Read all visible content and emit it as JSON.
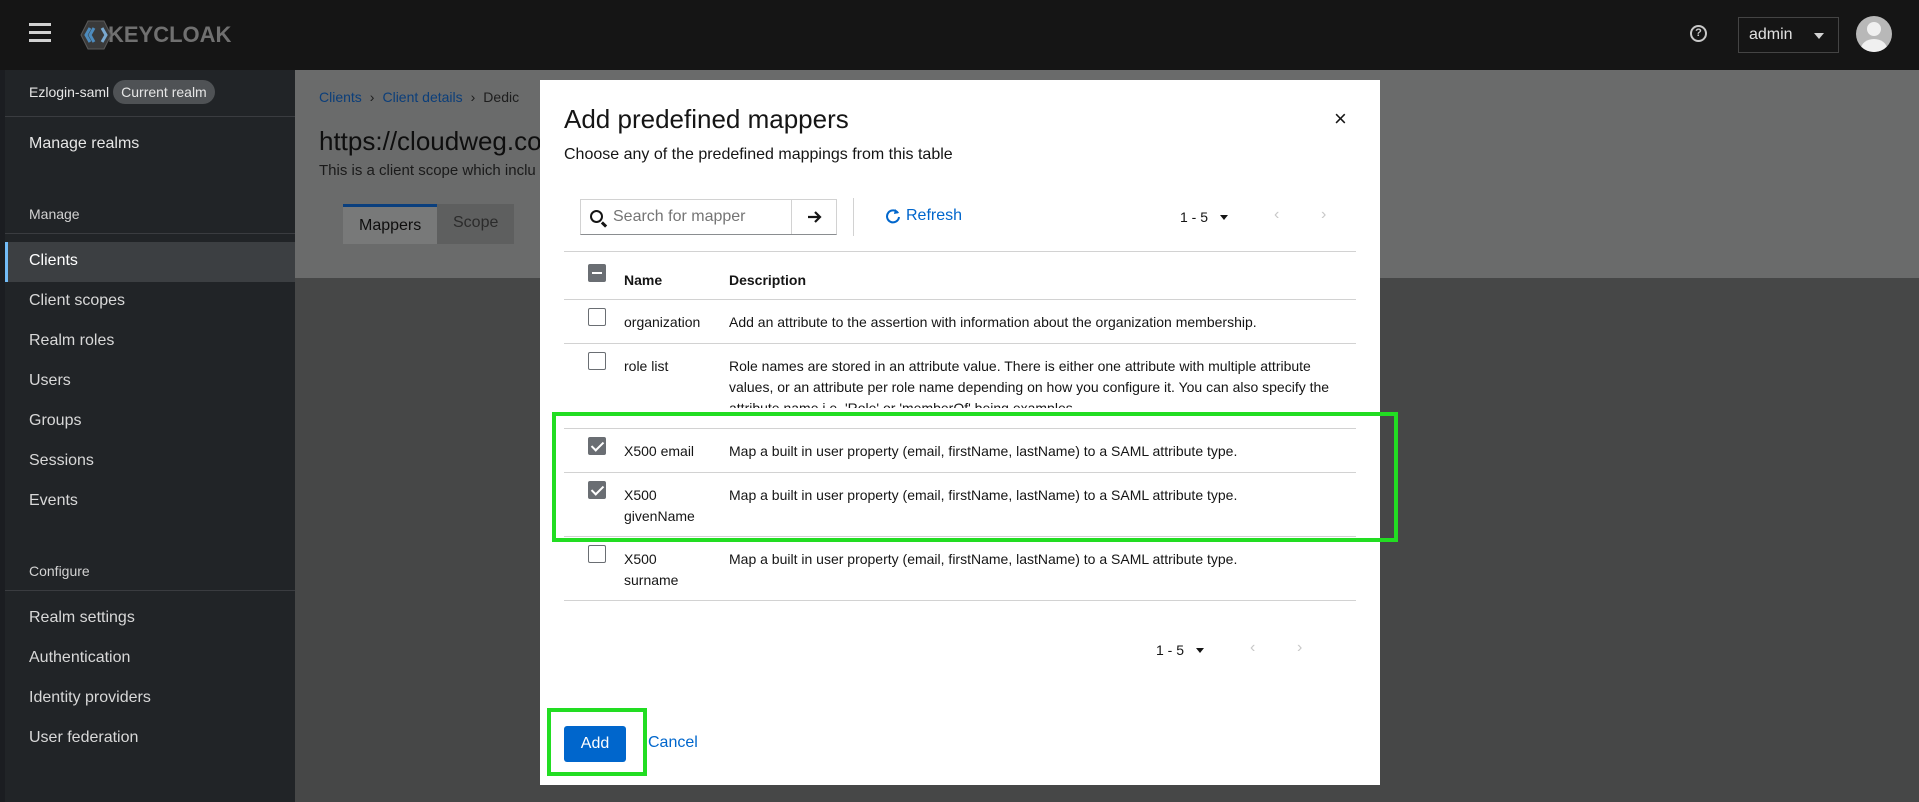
{
  "masthead": {
    "brand": "KEYCLOAK",
    "user": "admin",
    "help_glyph": "?"
  },
  "sidebar": {
    "realm_name": "Ezlogin-saml",
    "realm_badge": "Current realm",
    "manage_realms": "Manage realms",
    "manage_section": "Manage",
    "manage_items": [
      "Clients",
      "Client scopes",
      "Realm roles",
      "Users",
      "Groups",
      "Sessions",
      "Events"
    ],
    "configure_section": "Configure",
    "configure_items": [
      "Realm settings",
      "Authentication",
      "Identity providers",
      "User federation"
    ],
    "active_item": "Clients"
  },
  "page": {
    "breadcrumbs": [
      "Clients",
      "Client details",
      "Dedic"
    ],
    "title": "https://cloudweg.co",
    "subtitle": "This is a client scope which inclu",
    "tabs": [
      "Mappers",
      "Scope"
    ]
  },
  "modal": {
    "title": "Add predefined mappers",
    "description": "Choose any of the predefined mappings from this table",
    "close_glyph": "×",
    "search_placeholder": "Search for mapper",
    "refresh_label": "Refresh",
    "pagination_top": "1 - 5",
    "pagination_bottom": "1 - 5",
    "columns": {
      "name": "Name",
      "description": "Description"
    },
    "rows": [
      {
        "name_line1": "organization",
        "name_line2": "",
        "description": "Add an attribute to the assertion with information about the organization membership.",
        "checked": false
      },
      {
        "name_line1": "role list",
        "name_line2": "",
        "description": "Role names are stored in an attribute value. There is either one attribute with multiple attribute values, or an attribute per role name depending on how you configure it. You can also specify the attribute name i.e. 'Role' or 'memberOf' being examples.",
        "checked": false
      },
      {
        "name_line1": "X500 email",
        "name_line2": "",
        "description": "Map a built in user property (email, firstName, lastName) to a SAML attribute type.",
        "checked": true
      },
      {
        "name_line1": "X500",
        "name_line2": "givenName",
        "description": "Map a built in user property (email, firstName, lastName) to a SAML attribute type.",
        "checked": true
      },
      {
        "name_line1": "X500",
        "name_line2": "surname",
        "description": "Map a built in user property (email, firstName, lastName) to a SAML attribute type.",
        "checked": false
      }
    ],
    "add_label": "Add",
    "cancel_label": "Cancel"
  },
  "colors": {
    "primary": "#0066cc",
    "highlight": "#22dd22",
    "masthead": "#151515",
    "sidebar": "#212427"
  }
}
